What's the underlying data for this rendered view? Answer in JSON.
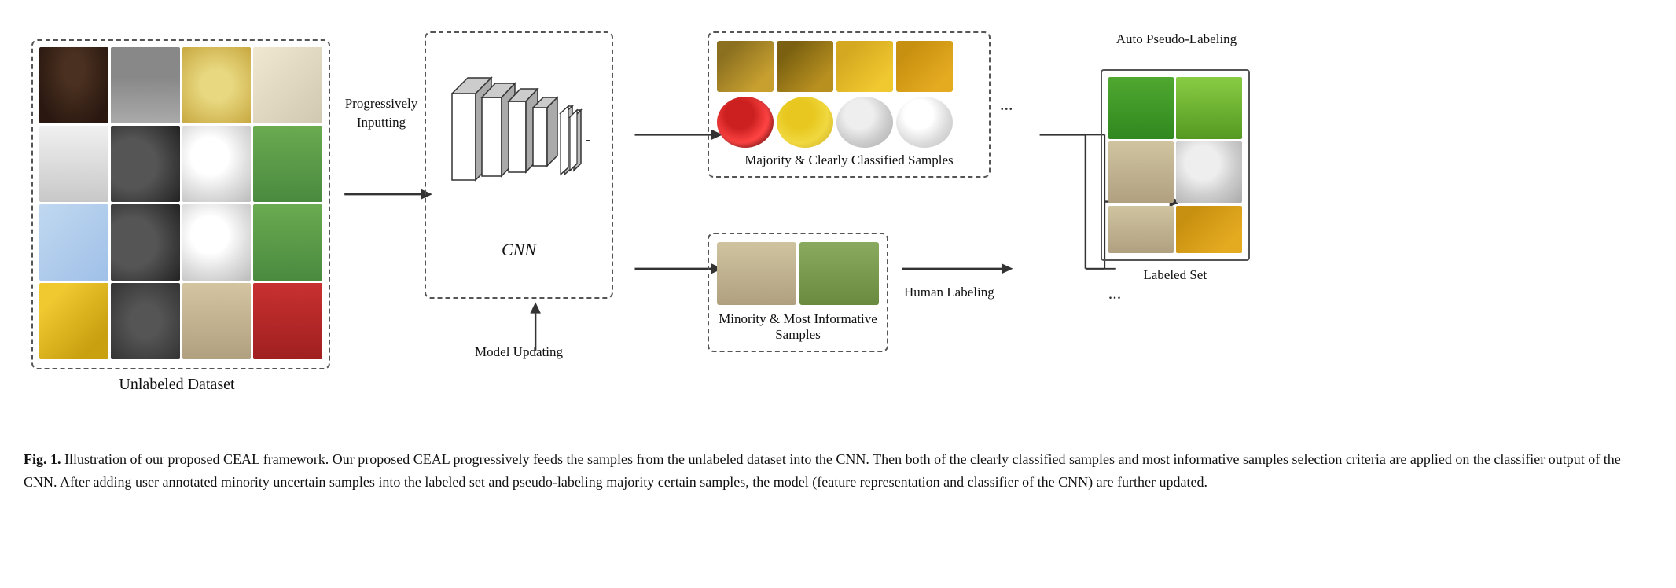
{
  "diagram": {
    "unlabeled_label": "Unlabeled Dataset",
    "progressively_inputting": "Progressively\nInputting",
    "progressively_line1": "Progressively",
    "progressively_line2": "Inputting",
    "cnn_label": "CNN",
    "model_updating": "Model Updating",
    "majority_label": "Majority & Clearly Classified Samples",
    "minority_label": "Minority & Most Informative Samples",
    "auto_pseudo_label": "Auto Pseudo-Labeling",
    "human_labeling": "Human Labeling",
    "labeled_set_label": "Labeled Set",
    "ellipsis": "...",
    "caption": {
      "fig_num": "Fig. 1.",
      "text": "   Illustration of our proposed CEAL framework. Our proposed CEAL progressively feeds the samples from the unlabeled dataset into the CNN. Then both of the clearly classified samples and most informative samples selection criteria are applied on the classifier output of the CNN. After adding user annotated minority uncertain samples into the labeled set and pseudo-labeling majority certain samples, the model (feature representation and classifier of the CNN) are further updated."
    }
  }
}
